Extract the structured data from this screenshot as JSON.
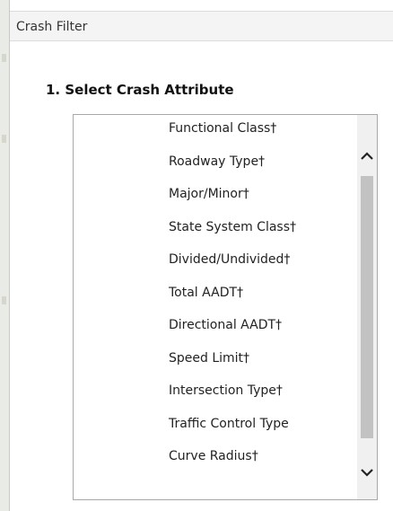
{
  "panel": {
    "title": "Crash Filter",
    "section_heading": "1. Select Crash Attribute"
  },
  "attribute_list": {
    "items": [
      "Functional Class†",
      "Roadway Type†",
      "Major/Minor†",
      "State System Class†",
      "Divided/Undivided†",
      "Total AADT†",
      "Directional AADT†",
      "Speed Limit†",
      "Intersection Type†",
      "Traffic Control Type",
      "Curve Radius†"
    ]
  },
  "scrollbar": {
    "up_icon": "chevron-up-icon",
    "down_icon": "chevron-down-icon"
  },
  "colors": {
    "header_bg": "#f4f4f4",
    "list_border": "#a8a8a8",
    "scroll_thumb": "#c2c2c2"
  }
}
